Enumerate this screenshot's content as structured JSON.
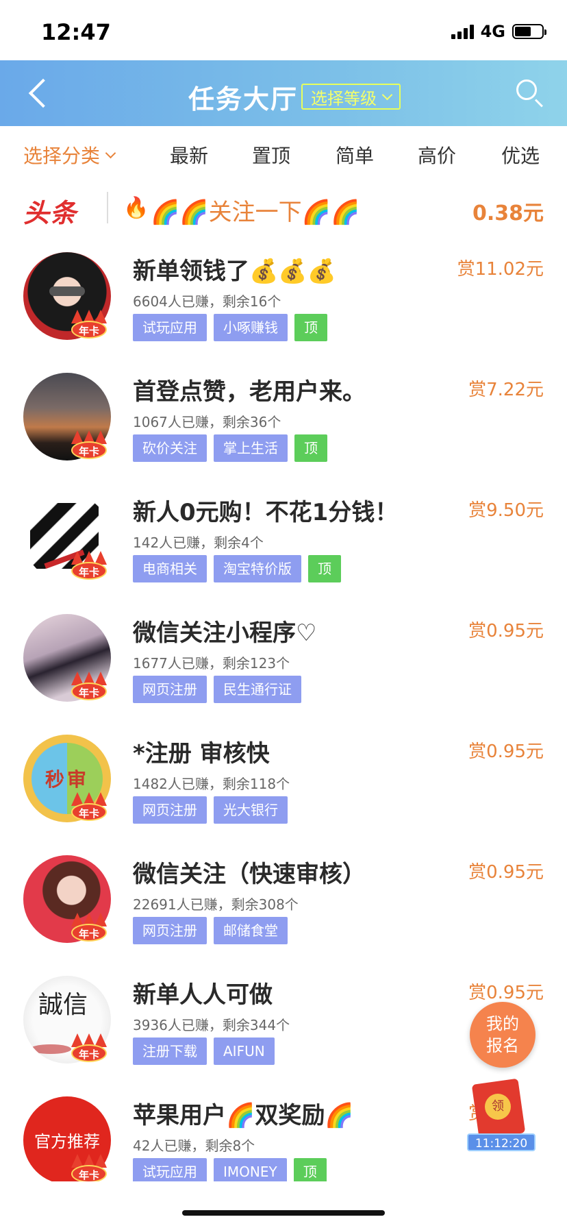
{
  "status_bar": {
    "time": "12:47",
    "network": "4G"
  },
  "header": {
    "title": "任务大厅",
    "level_select": "选择等级"
  },
  "filters": {
    "category": "选择分类",
    "tabs": [
      "最新",
      "置顶",
      "简单",
      "高价",
      "优选"
    ]
  },
  "headline": {
    "label": "头条",
    "emoji": "🔥",
    "text": "🌈🌈关注一下🌈🌈",
    "price": "0.38元"
  },
  "badge_text": "年卡",
  "tasks": [
    {
      "title": "新单领钱了💰💰💰",
      "meta": "6604人已赚，剩余16个",
      "reward": "赏11.02元",
      "tags": [
        "试玩应用",
        "小啄赚钱",
        "顶"
      ]
    },
    {
      "title": "首登点赞，老用户来。",
      "meta": "1067人已赚，剩余36个",
      "reward": "赏7.22元",
      "tags": [
        "砍价关注",
        "掌上生活",
        "顶"
      ]
    },
    {
      "title": "新人0元购！不花1分钱！",
      "meta": "142人已赚，剩余4个",
      "reward": "赏9.50元",
      "tags": [
        "电商相关",
        "淘宝特价版",
        "顶"
      ]
    },
    {
      "title": "微信关注小程序♡",
      "meta": "1677人已赚，剩余123个",
      "reward": "赏0.95元",
      "tags": [
        "网页注册",
        "民生通行证"
      ]
    },
    {
      "title": "*注册 审核快",
      "meta": "1482人已赚，剩余118个",
      "reward": "赏0.95元",
      "tags": [
        "网页注册",
        "光大银行"
      ]
    },
    {
      "title": "微信关注（快速审核）",
      "meta": "22691人已赚，剩余308个",
      "reward": "赏0.95元",
      "tags": [
        "网页注册",
        "邮储食堂"
      ]
    },
    {
      "title": "新单人人可做",
      "meta": "3936人已赚，剩余344个",
      "reward": "赏0.95元",
      "tags": [
        "注册下载",
        "AIFUN"
      ]
    },
    {
      "title": "苹果用户🌈双奖励🌈",
      "meta": "42人已赚，剩余8个",
      "reward": "赏",
      "tags": [
        "试玩应用",
        "IMONEY",
        "顶"
      ]
    }
  ],
  "avatar_texts": {
    "a5": "秒审",
    "a7": "誠信",
    "a8": "官方推荐"
  },
  "float": {
    "signup_line1": "我的",
    "signup_line2": "报名",
    "redpacket_coin": "领",
    "redpacket_timer": "11:12:20"
  },
  "colors": {
    "accent_orange": "#e8833a",
    "header_blue": "#6aa9e9",
    "tag_blue": "#8e9df0",
    "tag_green": "#5ccd5a",
    "headline_red": "#e02e2e"
  }
}
